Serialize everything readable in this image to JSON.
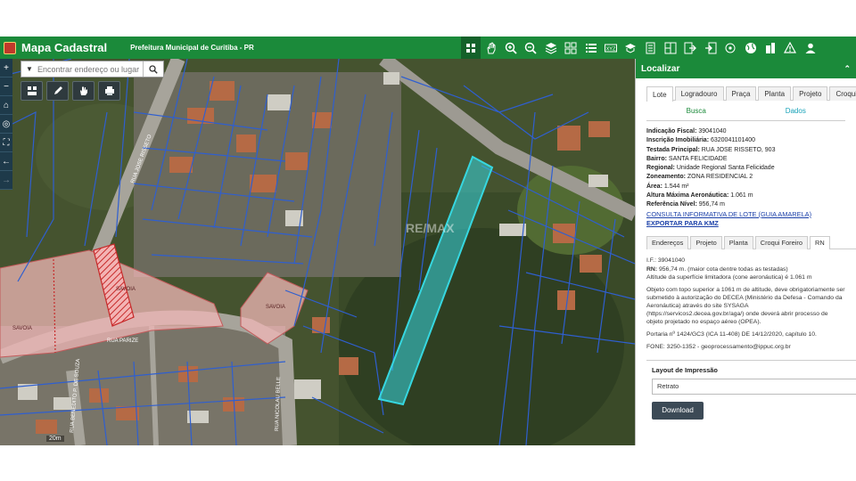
{
  "header": {
    "title": "Mapa Cadastral",
    "subtitle": "Prefeitura Municipal de Curitiba - PR"
  },
  "toolbar": {
    "icons": [
      "select-icon",
      "pan-hand-icon",
      "zoom-in-icon",
      "zoom-out-icon",
      "layers-icon",
      "grid-icon",
      "list-icon",
      "coordinates-icon",
      "graduation-icon",
      "report-icon",
      "split-icon",
      "export-icon",
      "import-icon",
      "locate-icon",
      "globe-icon",
      "building-icon",
      "warning-icon",
      "user-icon"
    ],
    "coord_label": "XYZ"
  },
  "map": {
    "search_placeholder": "Encontrar endereço ou lugar",
    "scale_label": "20m",
    "labels": [
      "SAVOIA",
      "SAVOIA",
      "SAVOIA",
      "RUA JOSE RISSETO",
      "RUA PARIZE",
      "RUA D. PARIZE",
      "RUA BENEDITO P. DE SOUZA",
      "RUA NICOLAU BELLE",
      "RE/MAX"
    ]
  },
  "panel": {
    "title": "Localizar",
    "tabs": [
      "Lote",
      "Logradouro",
      "Praça",
      "Planta",
      "Projeto",
      "Croqui Foreiro"
    ],
    "subtabs": [
      "Busca",
      "Dados"
    ],
    "fields": [
      {
        "label": "Indicação Fiscal:",
        "value": "39041040"
      },
      {
        "label": "Inscrição Imobiliária:",
        "value": "6320041101400"
      },
      {
        "label": "Testada Principal:",
        "value": "RUA JOSE RISSETO, 903"
      },
      {
        "label": "Bairro:",
        "value": "SANTA FELICIDADE"
      },
      {
        "label": "Regional:",
        "value": "Unidade Regional Santa Felicidade"
      },
      {
        "label": "Zoneamento:",
        "value": "ZONA RESIDENCIAL 2"
      },
      {
        "label": "Área:",
        "value": "1.544 m²"
      },
      {
        "label": "Altura Máxima Aeronáutica:",
        "value": "1.061 m"
      },
      {
        "label": "Referência Nível:",
        "value": "956,74 m"
      }
    ],
    "link_consulta": "CONSULTA INFORMATIVA DE LOTE (GUIA AMARELA)",
    "link_kmz": "EXPORTAR PARA KMZ",
    "tabs2": [
      "Endereços",
      "Projeto",
      "Planta",
      "Croqui Foreiro",
      "RN"
    ],
    "rn": {
      "if_line": "I.F.: 39041040",
      "rn_label": "RN:",
      "rn_value": "956,74 m. (maior cota dentre todas as testadas)",
      "altitude": "Altitude da superfície limitadora (cone aeronáutica) é 1.061 m",
      "objeto": "Objeto com topo superior a 1061 m de altitude, deve obrigatoriamente ser submetido à autorização do DECEA (Ministério da Defesa - Comando da Aeronáutica) através do site SYSAGA (https://servicos2.decea.gov.br/aga/) onde deverá abrir processo de objeto projetado no espaço aéreo (OPEA).",
      "portaria": "Portaria nº 1424/GC3 (ICA 11-408) DE 14/12/2020, capítulo 10.",
      "fone": "FONE: 3250-1352 - geoprocessamento@ippuc.org.br"
    },
    "print_label": "Layout de Impressão",
    "print_value": "Retrato",
    "download_label": "Download"
  },
  "colors": {
    "header_green": "#1b8a3a",
    "parcel_blue": "#2f5fd0",
    "selected_cyan": "#36d7e0",
    "hatch_red": "#d03a3a"
  }
}
